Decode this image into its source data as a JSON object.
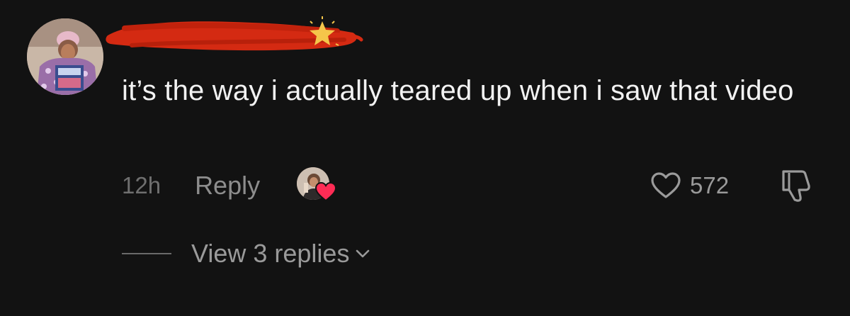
{
  "comment": {
    "text": "it’s the way i actually teared up when i saw that video",
    "timestamp": "12h",
    "reply_label": "Reply",
    "like_count": "572",
    "view_replies_label": "View 3 replies",
    "liked_by_creator": true
  },
  "icons": {
    "like": "heart-outline-icon",
    "dislike": "thumbs-down-icon",
    "expand": "chevron-down-icon",
    "emoji": "star-emoji"
  },
  "colors": {
    "background": "#121212",
    "redaction": "#d42a12",
    "creator_heart": "#fe2c55",
    "muted_text": "#8d8d8d"
  }
}
